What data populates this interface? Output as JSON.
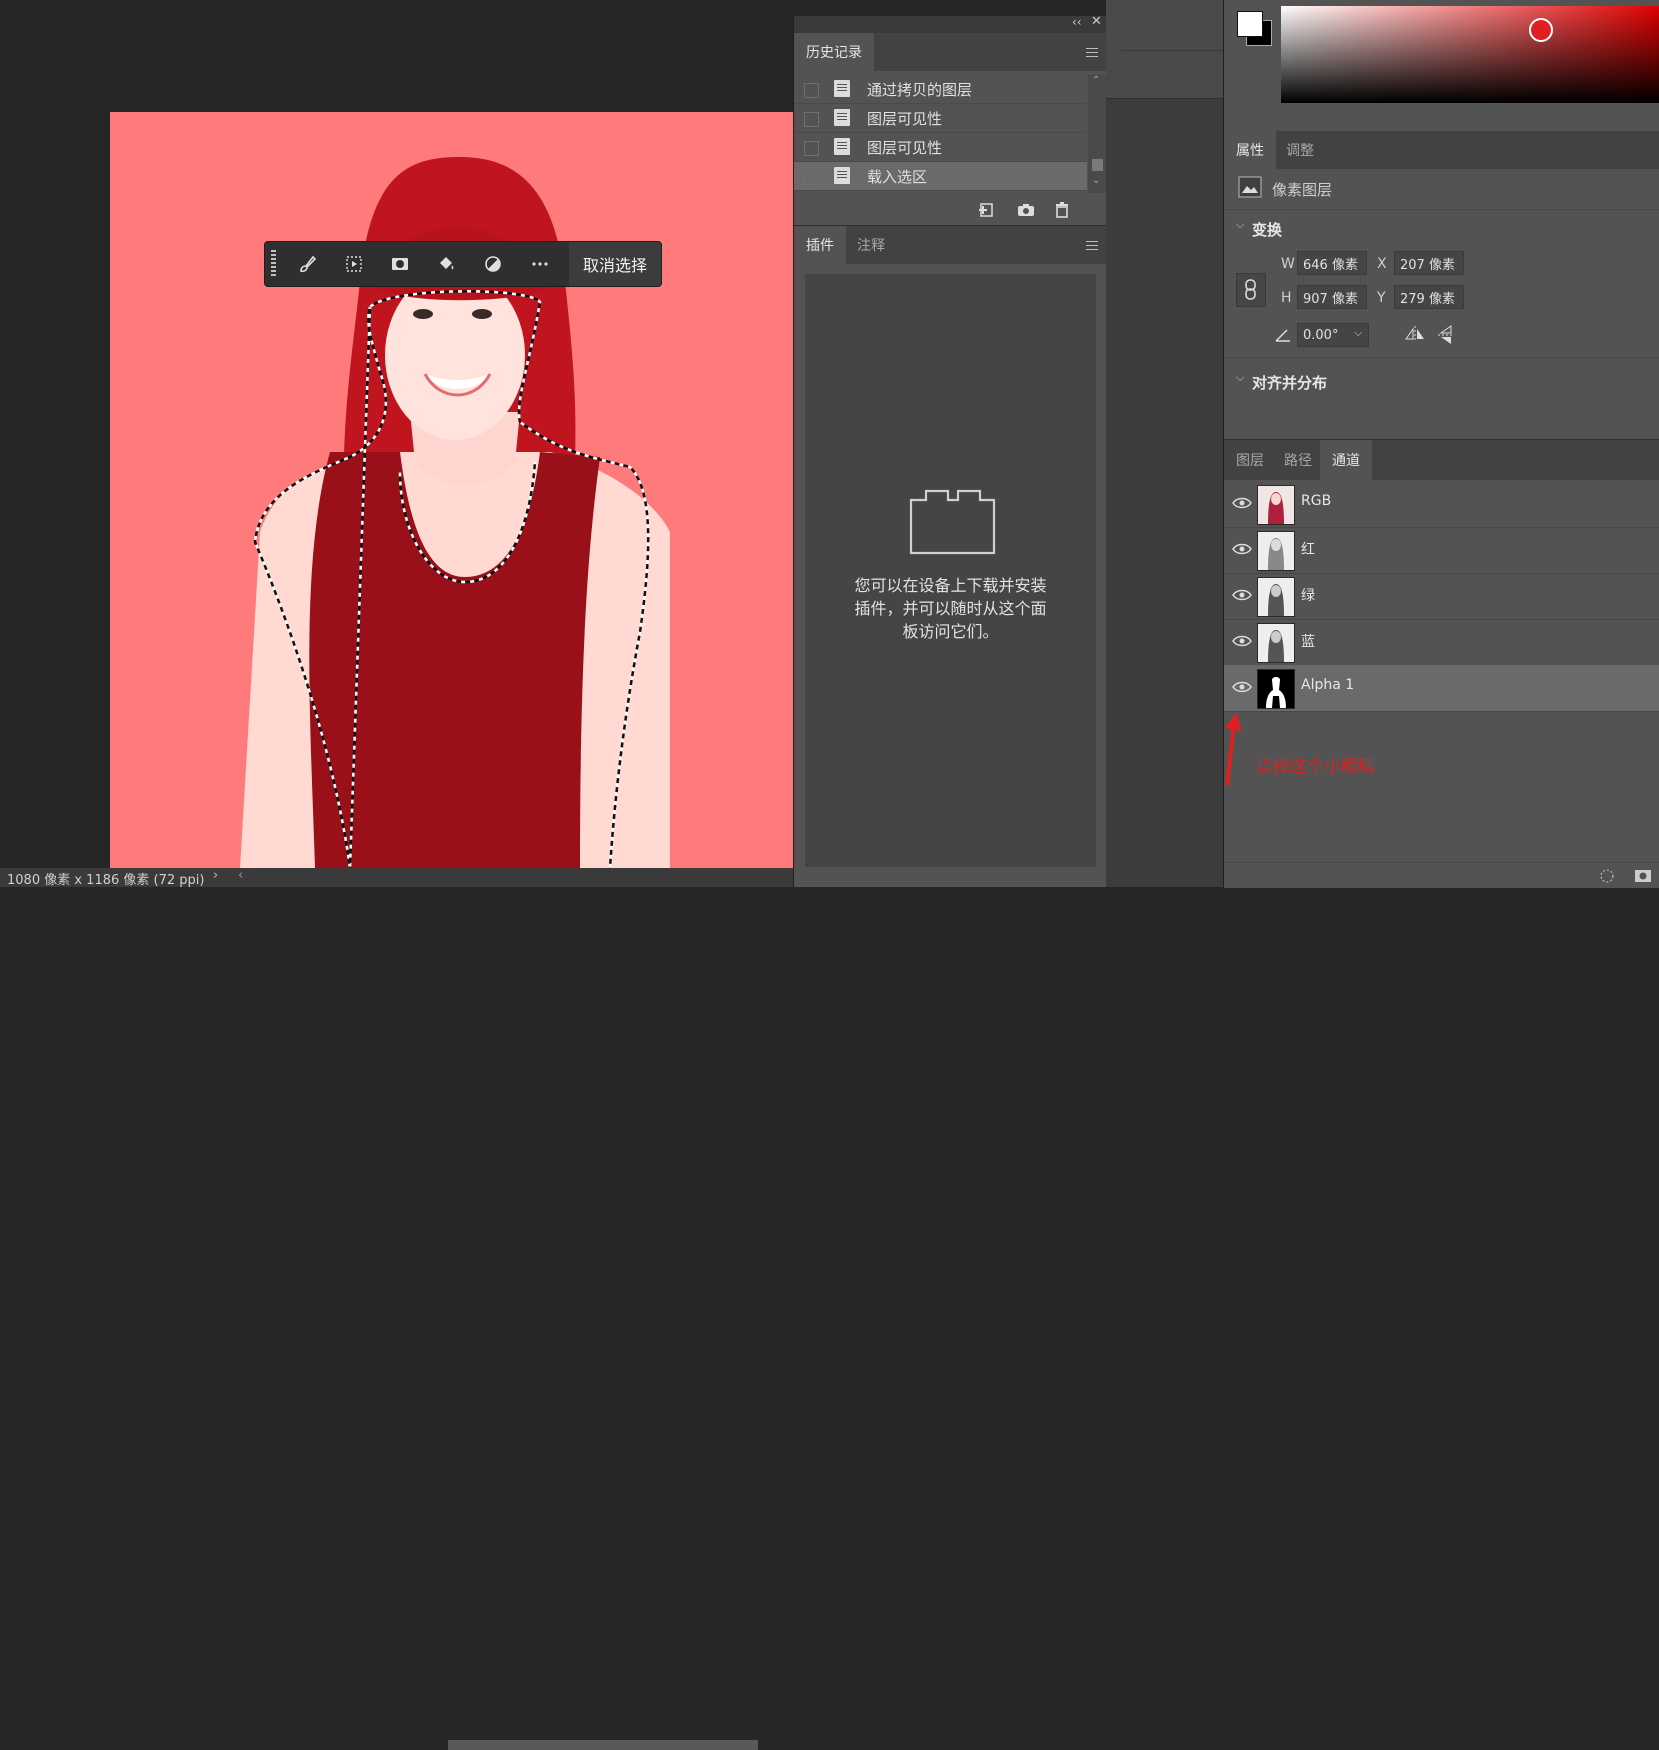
{
  "status_bar": {
    "info": "1080 像素 x 1186 像素 (72 ppi)"
  },
  "taskbar": {
    "deselect_label": "取消选择"
  },
  "history_panel": {
    "tab_label": "历史记录",
    "items": [
      {
        "label": "通过拷贝的图层"
      },
      {
        "label": "图层可见性"
      },
      {
        "label": "图层可见性"
      },
      {
        "label": "载入选区"
      }
    ]
  },
  "plugins_panel": {
    "tabs": [
      "插件",
      "注释"
    ],
    "message_line1": "您可以在设备上下载并安装",
    "message_line2": "插件，并可以随时从这个面",
    "message_line3": "板访问它们。"
  },
  "properties_panel": {
    "tabs": [
      "属性",
      "调整"
    ],
    "layer_type": "像素图层",
    "transform_title": "变换",
    "w_label": "W",
    "w_value": "646 像素",
    "x_label": "X",
    "x_value": "207 像素",
    "h_label": "H",
    "h_value": "907 像素",
    "y_label": "Y",
    "y_value": "279 像素",
    "angle_value": "0.00°",
    "align_title": "对齐并分布"
  },
  "channels_panel": {
    "tabs": [
      "图层",
      "路径",
      "通道"
    ],
    "active_tab": "通道",
    "channels": [
      {
        "name": "RGB"
      },
      {
        "name": "红"
      },
      {
        "name": "绿"
      },
      {
        "name": "蓝"
      },
      {
        "name": "Alpha 1"
      }
    ]
  },
  "annotation": {
    "text": "点掉这个小眼睛"
  },
  "colors": {
    "canvas_bg": "#ff7b7b",
    "hair": "#c0141e",
    "shirt": "#9a1019",
    "annotation": "#e02020"
  }
}
